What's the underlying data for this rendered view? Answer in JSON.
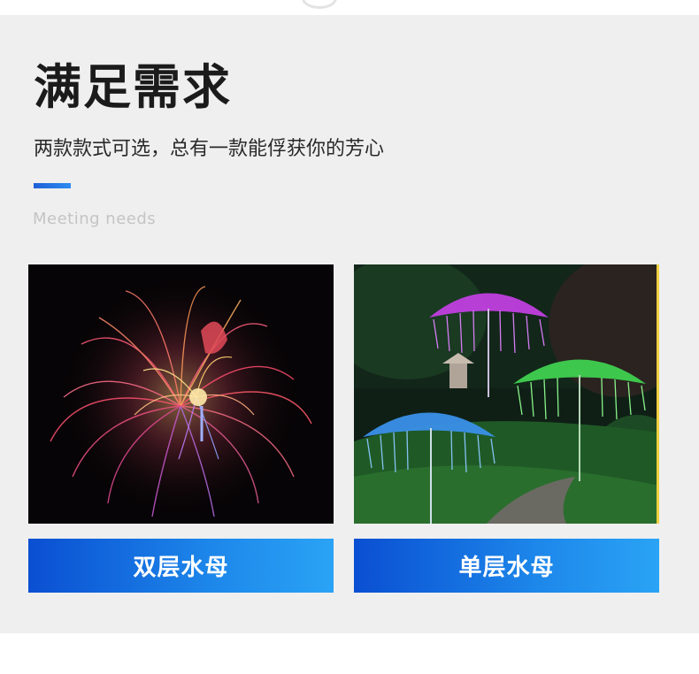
{
  "section": {
    "title": "满足需求",
    "subtitle": "两款款式可选，总有一款能俘获你的芳心",
    "english": "Meeting needs",
    "accent_color": "#1f5fd8"
  },
  "products": [
    {
      "label": "双层水母",
      "image_description": "double-layer fiber-optic jellyfish light"
    },
    {
      "label": "单层水母",
      "image_description": "single-layer fiber-optic jellyfish lights in garden"
    }
  ]
}
